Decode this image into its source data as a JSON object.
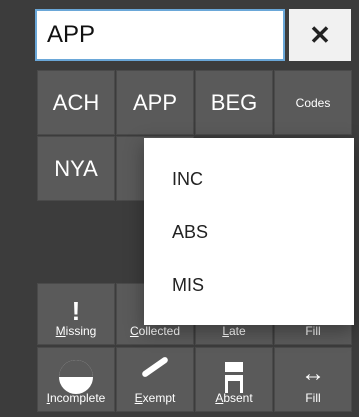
{
  "search": {
    "value": "APP"
  },
  "buttons": {
    "close": "✕"
  },
  "code_tiles": [
    {
      "label": "ACH"
    },
    {
      "label": "APP"
    },
    {
      "label": "BEG"
    },
    {
      "label": "Codes"
    },
    {
      "label": "NYA"
    }
  ],
  "dropdown": {
    "items": [
      {
        "label": "INC"
      },
      {
        "label": "ABS"
      },
      {
        "label": "MIS"
      }
    ]
  },
  "action_row_1": [
    {
      "label": "Missing",
      "underline_char": "M"
    },
    {
      "label": "Collected",
      "underline_char": "C"
    },
    {
      "label": "Late",
      "underline_char": "L"
    },
    {
      "label": "Fill",
      "underline_char": ""
    }
  ],
  "action_row_2": [
    {
      "label": "Incomplete",
      "underline_char": "I"
    },
    {
      "label": "Exempt",
      "underline_char": "E"
    },
    {
      "label": "Absent",
      "underline_char": "A"
    },
    {
      "label": "Fill",
      "underline_char": ""
    }
  ]
}
